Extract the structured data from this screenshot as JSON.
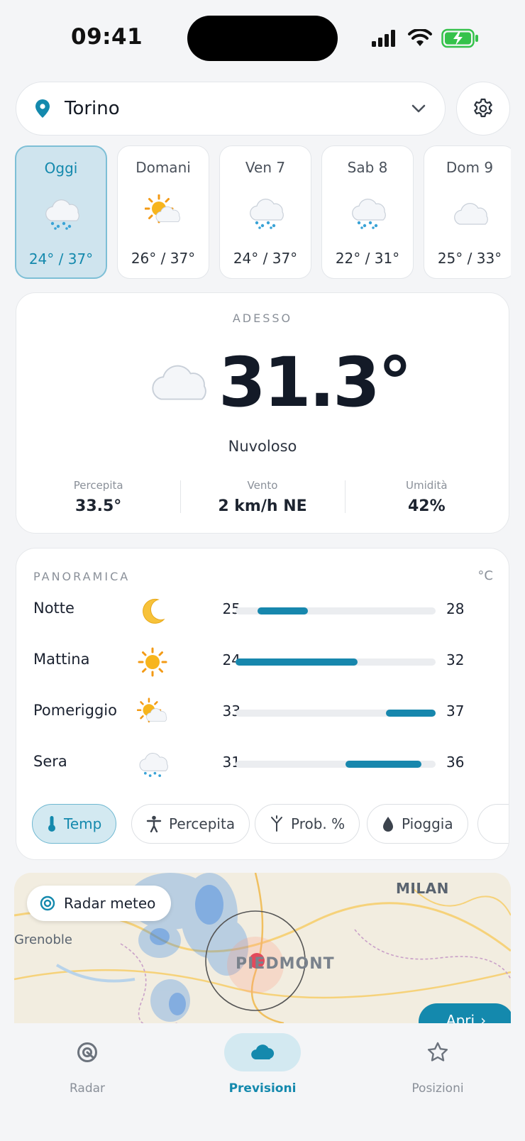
{
  "status": {
    "time": "09:41"
  },
  "location": {
    "name": "Torino"
  },
  "days": [
    {
      "name": "Oggi",
      "temps": "24° / 37°",
      "icon": "rain-cloud-icon",
      "active": true
    },
    {
      "name": "Domani",
      "temps": "26° / 37°",
      "icon": "sun-cloud-icon"
    },
    {
      "name": "Ven 7",
      "temps": "24° / 37°",
      "icon": "rain-cloud-icon"
    },
    {
      "name": "Sab 8",
      "temps": "22° / 31°",
      "icon": "rain-cloud-icon"
    },
    {
      "name": "Dom 9",
      "temps": "25° / 33°",
      "icon": "cloud-icon"
    }
  ],
  "now": {
    "label": "ADESSO",
    "temp": "31.3°",
    "description": "Nuvoloso",
    "icon": "cloud-icon",
    "stats": [
      {
        "label": "Percepita",
        "value": "33.5°"
      },
      {
        "label": "Vento",
        "value": "2 km/h NE"
      },
      {
        "label": "Umidità",
        "value": "42%"
      }
    ]
  },
  "overview": {
    "title": "PANORAMICA",
    "unit": "°C",
    "scale": [
      20,
      40
    ],
    "rows": [
      {
        "name": "Notte",
        "icon": "moon-icon",
        "min": "25",
        "max": "28",
        "bar_start": 0.11,
        "bar_end": 0.36
      },
      {
        "name": "Mattina",
        "icon": "sun-icon",
        "min": "24",
        "max": "32",
        "bar_start": 0.0,
        "bar_end": 0.61
      },
      {
        "name": "Pomeriggio",
        "icon": "sun-cloud-icon",
        "min": "33",
        "max": "37",
        "bar_start": 0.75,
        "bar_end": 1.0
      },
      {
        "name": "Sera",
        "icon": "rain-cloud-icon",
        "min": "31",
        "max": "36",
        "bar_start": 0.55,
        "bar_end": 0.93
      }
    ],
    "chips": [
      {
        "label": "Temp",
        "icon": "thermometer-icon",
        "active": true
      },
      {
        "label": "Percepita",
        "icon": "person-icon"
      },
      {
        "label": "Prob. %",
        "icon": "umbrella-icon"
      },
      {
        "label": "Pioggia",
        "icon": "drop-icon"
      }
    ]
  },
  "radar": {
    "pill_label": "Radar meteo",
    "open_label": "Apri",
    "map_labels": {
      "milan": "MILAN",
      "grenoble": "Grenoble",
      "piedmont": "PIEDMONT"
    }
  },
  "tabs": [
    {
      "label": "Radar",
      "icon": "radar-icon"
    },
    {
      "label": "Previsioni",
      "icon": "cloud-icon",
      "active": true
    },
    {
      "label": "Posizioni",
      "icon": "star-icon"
    }
  ],
  "colors": {
    "accent": "#1489ad",
    "bar": "#1787ad",
    "active_bg": "#d3e9f1"
  }
}
